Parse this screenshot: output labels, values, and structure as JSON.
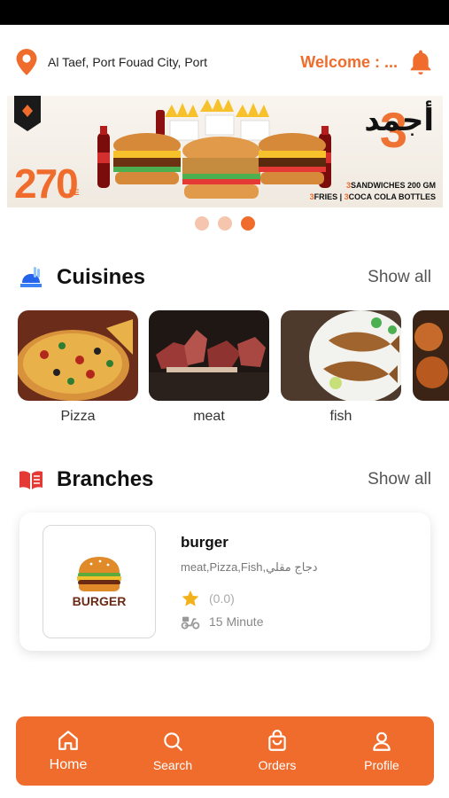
{
  "header": {
    "location": "Al Taef, Port Fouad City, Port",
    "welcome": "Welcome : ..."
  },
  "banner": {
    "price": "270",
    "currency": "LE",
    "arabic_title": "أجمد",
    "number": "3",
    "line1_num": "3",
    "line1_text": "SANDWICHES 200 GM",
    "line2_num1": "3",
    "line2_text1": "FRIES | ",
    "line2_num2": "3",
    "line2_text2": "COCA COLA BOTTLES",
    "slides_total": 3,
    "active_slide": 3
  },
  "cuisines": {
    "title": "Cuisines",
    "show_all": "Show all",
    "items": [
      {
        "label": "Pizza"
      },
      {
        "label": "meat"
      },
      {
        "label": "fish"
      }
    ]
  },
  "branches": {
    "title": "Branches",
    "show_all": "Show all",
    "items": [
      {
        "name": "burger",
        "logo_text": "BURGER",
        "tags": "meat,Pizza,Fish,دجاج مقلي",
        "rating": "(0.0)",
        "time": "15 Minute"
      }
    ]
  },
  "nav": {
    "items": [
      {
        "label": "Home",
        "icon": "home-icon",
        "active": true
      },
      {
        "label": "Search",
        "icon": "search-icon",
        "active": false
      },
      {
        "label": "Orders",
        "icon": "bag-icon",
        "active": false
      },
      {
        "label": "Profile",
        "icon": "user-icon",
        "active": false
      }
    ]
  },
  "colors": {
    "accent": "#ef6c2c",
    "dot_inactive": "#f5c6ad",
    "star": "#f2b21c"
  }
}
